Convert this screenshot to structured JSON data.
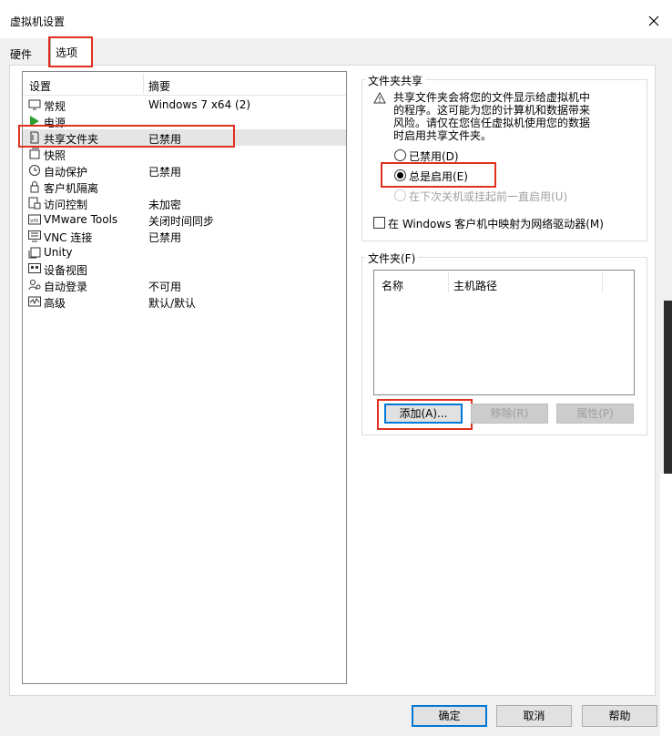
{
  "window": {
    "title": "虚拟机设置"
  },
  "tabs": [
    {
      "label": "硬件"
    },
    {
      "label": "选项"
    }
  ],
  "settings_list": {
    "columns": [
      "设置",
      "摘要"
    ],
    "rows": [
      {
        "name": "常规",
        "summary": "Windows 7 x64 (2)",
        "icon": "monitor-icon"
      },
      {
        "name": "电源",
        "summary": "",
        "icon": "play-icon"
      },
      {
        "name": "共享文件夹",
        "summary": "已禁用",
        "icon": "shared-folder-icon"
      },
      {
        "name": "快照",
        "summary": "",
        "icon": "snapshot-icon"
      },
      {
        "name": "自动保护",
        "summary": "已禁用",
        "icon": "clock-icon"
      },
      {
        "name": "客户机隔离",
        "summary": "",
        "icon": "lock-icon"
      },
      {
        "name": "访问控制",
        "summary": "未加密",
        "icon": "access-control-icon"
      },
      {
        "name": "VMware Tools",
        "summary": "关闭时间同步",
        "icon": "vm-icon"
      },
      {
        "name": "VNC 连接",
        "summary": "已禁用",
        "icon": "vnc-icon"
      },
      {
        "name": "Unity",
        "summary": "",
        "icon": "unity-icon"
      },
      {
        "name": "设备视图",
        "summary": "",
        "icon": "device-view-icon"
      },
      {
        "name": "自动登录",
        "summary": "不可用",
        "icon": "autologin-icon"
      },
      {
        "name": "高级",
        "summary": "默认/默认",
        "icon": "advanced-icon"
      }
    ],
    "selected_index": 2
  },
  "shared_folders": {
    "group_title": "文件夹共享",
    "warning": "共享文件夹会将您的文件显示给虚拟机中的程序。这可能为您的计算机和数据带来风险。请仅在您信任虚拟机使用您的数据时启用共享文件夹。",
    "options": [
      {
        "label": "已禁用(D)",
        "checked": false,
        "enabled": true
      },
      {
        "label": "总是启用(E)",
        "checked": true,
        "enabled": true
      },
      {
        "label": "在下次关机或挂起前一直启用(U)",
        "checked": false,
        "enabled": false
      }
    ],
    "map_drive_label": "在 Windows 客户机中映射为网络驱动器(M)",
    "map_drive_checked": false
  },
  "folders": {
    "group_title": "文件夹(F)",
    "columns": [
      "名称",
      "主机路径"
    ],
    "buttons": {
      "add": "添加(A)...",
      "remove": "移除(R)",
      "properties": "属性(P)"
    }
  },
  "dialog_buttons": {
    "ok": "确定",
    "cancel": "取消",
    "help": "帮助"
  },
  "colors": {
    "highlight": "#e0301e",
    "accent": "#0078d7"
  }
}
